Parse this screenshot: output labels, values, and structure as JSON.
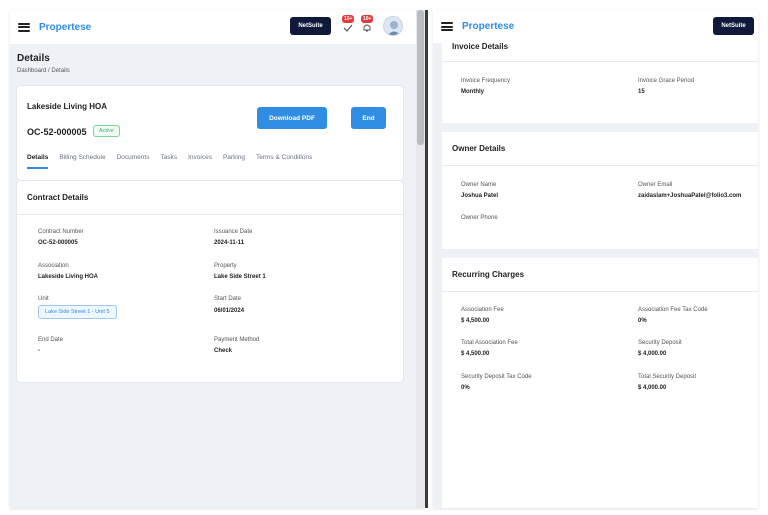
{
  "app": {
    "brand": "Propertese",
    "netsuite_label": "NetSuite"
  },
  "header": {
    "notif_badge_1": "10+",
    "notif_badge_2": "10+"
  },
  "page": {
    "title": "Details",
    "breadcrumb": "Dashboard / Details"
  },
  "contract": {
    "hoa_name": "Lakeside Living HOA",
    "id": "OC-52-000005",
    "status": "Active",
    "download_label": "Download PDF",
    "end_label": "End"
  },
  "tabs": [
    "Details",
    "Billing Schedule",
    "Documents",
    "Tasks",
    "Invoices",
    "Parking",
    "Terms & Conditions"
  ],
  "contract_details": {
    "title": "Contract Details",
    "fields": [
      {
        "label": "Contract Number",
        "value": "OC-52-000005"
      },
      {
        "label": "Issuance Date",
        "value": "2024-11-11"
      },
      {
        "label": "Association",
        "value": "Lakeside Living HOA"
      },
      {
        "label": "Property",
        "value": "Lake Side Street 1"
      },
      {
        "label": "Unit",
        "value": "Lake Side Street 1 - Unit 5"
      },
      {
        "label": "Start Date",
        "value": "06/01/2024"
      },
      {
        "label": "End Date",
        "value": "-"
      },
      {
        "label": "Payment Method",
        "value": "Check"
      }
    ]
  },
  "invoice_details": {
    "title": "Invoice Details",
    "fields": [
      {
        "label": "Invoice Frequency",
        "value": "Monthly"
      },
      {
        "label": "Invoice Grace Period",
        "value": "15"
      }
    ]
  },
  "owner_details": {
    "title": "Owner Details",
    "fields": [
      {
        "label": "Owner Name",
        "value": "Joshua Patel"
      },
      {
        "label": "Owner Email",
        "value": "zaidaslam+JoshuaPatel@folio3.com"
      },
      {
        "label": "Owner Phone",
        "value": ""
      }
    ]
  },
  "recurring_charges": {
    "title": "Recurring Charges",
    "fields": [
      {
        "label": "Association Fee",
        "value": "$ 4,500.00"
      },
      {
        "label": "Association Fee Tax Code",
        "value": "0%"
      },
      {
        "label": "Total Association Fee",
        "value": "$ 4,500.00"
      },
      {
        "label": "Security Deposit",
        "value": "$ 4,000.00"
      },
      {
        "label": "Security Deposit Tax Code",
        "value": "0%"
      },
      {
        "label": "Total Security Deposit",
        "value": "$ 4,000.00"
      }
    ]
  },
  "colors": {
    "accent": "#2f8de4",
    "navy": "#0f1a3a",
    "success": "#3bb36a",
    "alert": "#e23b3b"
  }
}
